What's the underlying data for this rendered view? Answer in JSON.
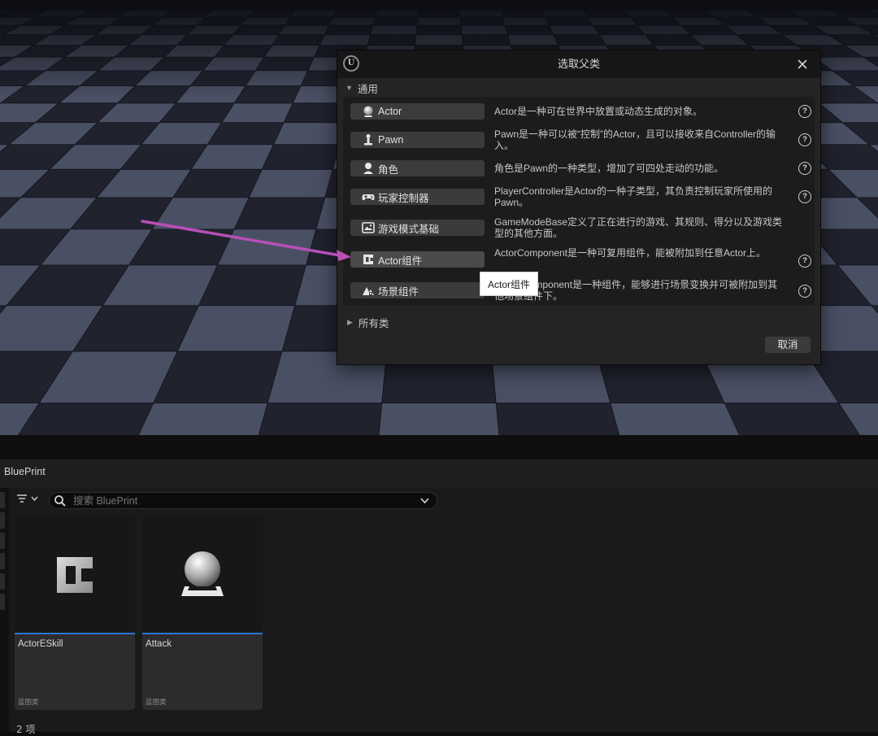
{
  "dialog": {
    "title": "选取父类",
    "logo_text": "U",
    "section_common": "通用",
    "rows": [
      {
        "label": "Actor",
        "icon": "actor-sphere-icon",
        "description": "Actor是一种可在世界中放置或动态生成的对象。"
      },
      {
        "label": "Pawn",
        "icon": "pawn-icon",
        "description": "Pawn是一种可以被“控制”的Actor，且可以接收来自Controller的输入。"
      },
      {
        "label": "角色",
        "icon": "character-icon",
        "description": "角色是Pawn的一种类型，增加了可四处走动的功能。"
      },
      {
        "label": "玩家控制器",
        "icon": "gamepad-icon",
        "description": "PlayerController是Actor的一种子类型，其负责控制玩家所使用的Pawn。"
      },
      {
        "label": "游戏模式基础",
        "icon": "game-mode-icon",
        "description": "GameModeBase定义了正在进行的游戏、其规则、得分以及游戏类型的其他方面。"
      },
      {
        "label": "Actor组件",
        "icon": "actor-component-icon",
        "description": "ActorComponent是一种可复用组件，能被附加到任意Actor上。"
      },
      {
        "label": "场景组件",
        "icon": "scene-component-icon",
        "description": "SceneComponent是一种组件，能够进行场景变换并可被附加到其他场景组件下。"
      }
    ],
    "all_classes": "所有类",
    "cancel": "取消"
  },
  "tooltip": "Actor组件",
  "browser": {
    "tab_title": "BluePrint",
    "search_placeholder": "搜索 BluePrint",
    "assets": [
      {
        "name": "ActorESkill",
        "type": "蓝图类",
        "icon": "actor-component-icon"
      },
      {
        "name": "Attack",
        "type": "蓝图类",
        "icon": "actor-sphere-icon"
      }
    ],
    "item_count": "2 项"
  },
  "colors": {
    "accent_blue": "#2a78d4",
    "annotation_arrow": "#b84fb8"
  }
}
